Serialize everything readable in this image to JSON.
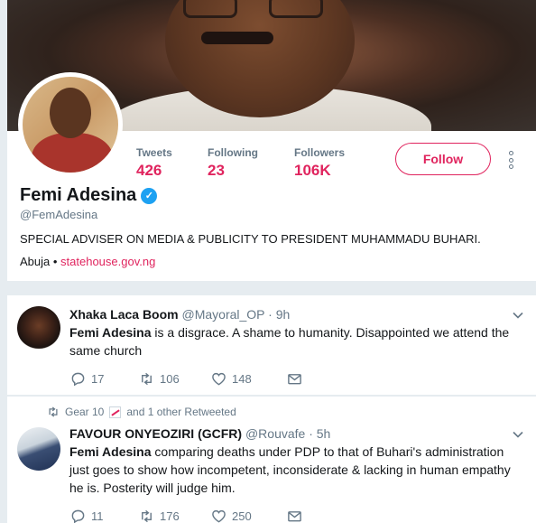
{
  "profile": {
    "name": "Femi Adesina",
    "handle": "@FemAdesina",
    "verified_icon": "verified-badge",
    "bio": "SPECIAL ADVISER ON MEDIA & PUBLICITY TO PRESIDENT MUHAMMADU BUHARI.",
    "location": "Abuja",
    "separator": " • ",
    "website": "statehouse.gov.ng"
  },
  "stats": {
    "tweets_label": "Tweets",
    "tweets_value": "426",
    "following_label": "Following",
    "following_value": "23",
    "followers_label": "Followers",
    "followers_value": "106K"
  },
  "actions": {
    "follow_label": "Follow"
  },
  "tweets": [
    {
      "name": "Xhaka Laca Boom",
      "handle": "@Mayoral_OP",
      "time": " · 9h",
      "text_bold": "Femi Adesina",
      "text_rest": " is a disgrace. A shame to humanity.  Disappointed we attend the same church",
      "replies": "17",
      "retweets": "106",
      "likes": "148"
    },
    {
      "retweet_context": "Gear 10",
      "retweet_context_rest": "and 1 other Retweeted",
      "name": "FAVOUR ONYEOZIRI (GCFR)",
      "handle": "@Rouvafe",
      "time": " · 5h",
      "text_bold": "Femi Adesina",
      "text_rest": " comparing deaths under PDP to that of Buhari's administration just goes to show how incompetent, inconsiderate & lacking in human empathy he is. Posterity will judge him.",
      "replies": "11",
      "retweets": "176",
      "likes": "250"
    }
  ],
  "colors": {
    "accent": "#e0245e",
    "verified": "#1da1f2",
    "muted": "#657786",
    "background": "#e6ecf0"
  }
}
